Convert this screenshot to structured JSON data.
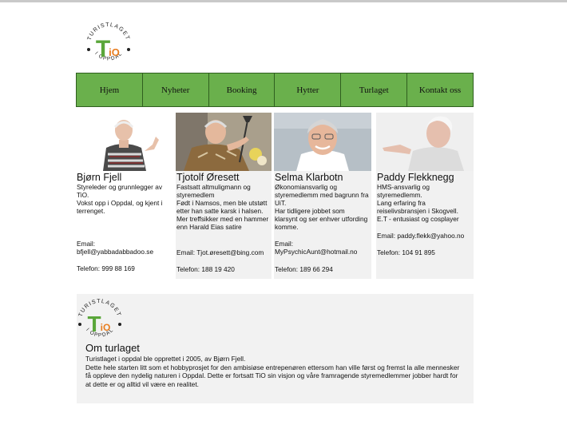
{
  "logo": {
    "arc_top": "TURISTLAGET",
    "arc_bottom": "I OPPDAL",
    "letter_t": "T",
    "letters_io": "iO",
    "colors": {
      "green": "#5aa63a",
      "orange": "#e87d1e",
      "ring": "#222222"
    }
  },
  "nav": {
    "items": [
      {
        "label": "Hjem"
      },
      {
        "label": "Nyheter"
      },
      {
        "label": "Booking"
      },
      {
        "label": "Hytter"
      },
      {
        "label": "Turlaget"
      },
      {
        "label": "Kontakt oss"
      }
    ]
  },
  "team": [
    {
      "name": "Bjørn Fjell",
      "role": "Styreleder og grunnlegger av TiO.\nVokst opp i Oppdal, og kjent i terrenget.",
      "email": "Email:\nbfjell@yabbadabbadoo.se",
      "phone": "Telefon: 999 88 169"
    },
    {
      "name": "Tjotolf Øresett",
      "role": "Fastsatt altmulig­mann og styremedlem\nFødt i Namsos, men ble utstøtt etter han satte karsk i halsen.\nMer treffsikker med en hammer enn Harald Eias satire",
      "email": "Email: Tjot.øresett@bing.com",
      "phone": "Telefon: 188 19 420"
    },
    {
      "name": "Selma Klarbotn",
      "role": "Økonomiansvarlig og styremedlemm med bagrunn fra UiT.\nHar tidligere jobbet som klarsynt og ser enhver utfording komme.",
      "email": "Email:\nMyPsychicAunt@hotmail.no",
      "phone": "Telefon:  189 66 294"
    },
    {
      "name": "Paddy Flekknegg",
      "role": "HMS-ansvarlig og styremedlemm.\nLang erfaring fra reiselivsbransjen i Skogvell.\nE.T - entusiast og cosplayer",
      "email": "Email: paddy.flekk@yahoo.no",
      "phone": "Telefon: 104 91 895"
    }
  ],
  "about": {
    "title": "Om turlaget",
    "text": "Turistlaget i oppdal ble opprettet i 2005, av Bjørn Fjell.\nDette  hele starten litt som et hobbyprosjet for den ambisiøse entrepenøren ettersom han ville først og fremst la alle mennesker få oppleve den nydelig naturen i Oppdal. Dette er fortsatt TiO sin visjon og våre framragende styremedlemmer jobber hardt for at dette er og alltid vil være en realitet."
  }
}
